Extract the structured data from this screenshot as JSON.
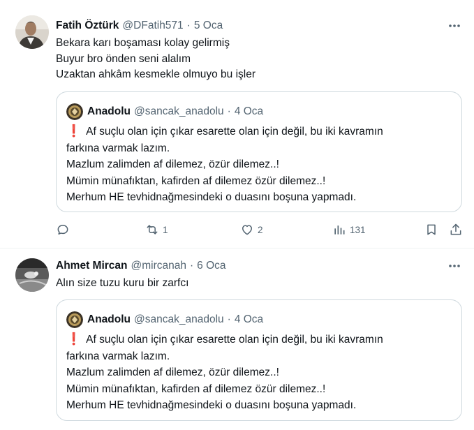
{
  "tweets": [
    {
      "name": "Fatih Öztürk",
      "handle": "@DFatih571",
      "separator": "·",
      "date": "5 Oca",
      "more_icon": "more-dots-icon",
      "lines": [
        "Bekara karı boşaması kolay gelirmiş",
        "Buyur bro önden seni alalım",
        "Uzaktan ahkâm kesmekle olmuyo bu işler"
      ],
      "quote": {
        "name": "Anadolu",
        "handle": "@sancak_anadolu",
        "separator": "·",
        "date": "4 Oca",
        "emoji": "❗",
        "lines": [
          "Af suçlu olan için çıkar esarette olan için değil, bu iki kavramın",
          "farkına varmak lazım.",
          "Mazlum zalimden af dilemez, özür dilemez..!",
          "Mümin münafıktan, kafirden af dilemez özür dilemez..!",
          "Merhum HE tevhidnağmesindeki o duasını boşuna yapmadı."
        ]
      },
      "actions": {
        "reply": {
          "icon": "reply-icon",
          "count": ""
        },
        "retweet": {
          "icon": "retweet-icon",
          "count": "1"
        },
        "like": {
          "icon": "heart-icon",
          "count": "2"
        },
        "views": {
          "icon": "views-icon",
          "count": "131"
        },
        "bookmark": {
          "icon": "bookmark-icon"
        },
        "share": {
          "icon": "share-icon"
        }
      }
    },
    {
      "name": "Ahmet Mircan",
      "handle": "@mircanah",
      "separator": "·",
      "date": "6 Oca",
      "more_icon": "more-dots-icon",
      "lines": [
        "Alın size tuzu kuru bir zarfcı"
      ],
      "quote": {
        "name": "Anadolu",
        "handle": "@sancak_anadolu",
        "separator": "·",
        "date": "4 Oca",
        "emoji": "❗",
        "lines": [
          "Af suçlu olan için çıkar esarette olan için değil, bu iki kavramın",
          "farkına varmak lazım.",
          "Mazlum zalimden af dilemez, özür dilemez..!",
          "Mümin münafıktan, kafirden af dilemez özür dilemez..!",
          "Merhum HE tevhidnağmesindeki o duasını boşuna yapmadı."
        ]
      }
    }
  ],
  "colors": {
    "text_primary": "#0f1419",
    "text_secondary": "#536471",
    "border": "#cfd9de",
    "divider": "#eff3f4",
    "alert_red": "#d9262f"
  }
}
